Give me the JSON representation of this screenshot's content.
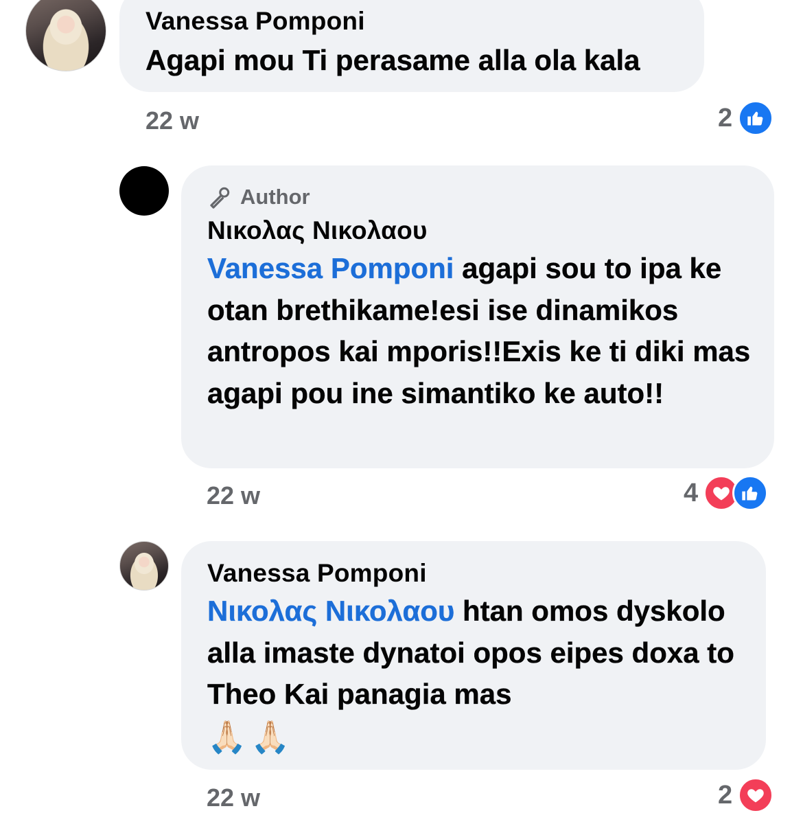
{
  "comments": [
    {
      "author": "Vanessa Pomponi",
      "text": "Agapi mou Ti perasame alla ola kala",
      "time": "22 w",
      "reaction_count": "2",
      "reactions": [
        "like-icon"
      ]
    },
    {
      "badge": "Author",
      "badge_icon": "microphone-icon",
      "author": "Νικολας Νικολαου",
      "mention": "Vanessa Pomponi",
      "text": " agapi sou to ipa ke otan brethikame!esi ise dinamikos antropos kai mporis!!Exis ke ti diki mas agapi pou ine simantiko ke auto!!",
      "time": "22 w",
      "reaction_count": "4",
      "reactions": [
        "love-icon",
        "like-icon"
      ]
    },
    {
      "author": "Vanessa Pomponi",
      "mention": "Νικολας Νικολαου",
      "text": " htan omos dyskolo alla imaste dynatoi opos eipes doxa to Theo Kai panagia mas",
      "emoji": [
        "🙏🏻",
        "🙏🏻"
      ],
      "time": "22 w",
      "reaction_count": "2",
      "reactions": [
        "love-icon"
      ]
    }
  ],
  "colors": {
    "bubble": "#f0f2f5",
    "mention": "#1c6ed8",
    "meta": "#65676b",
    "like": "#1877f2",
    "love": "#f33e58"
  }
}
